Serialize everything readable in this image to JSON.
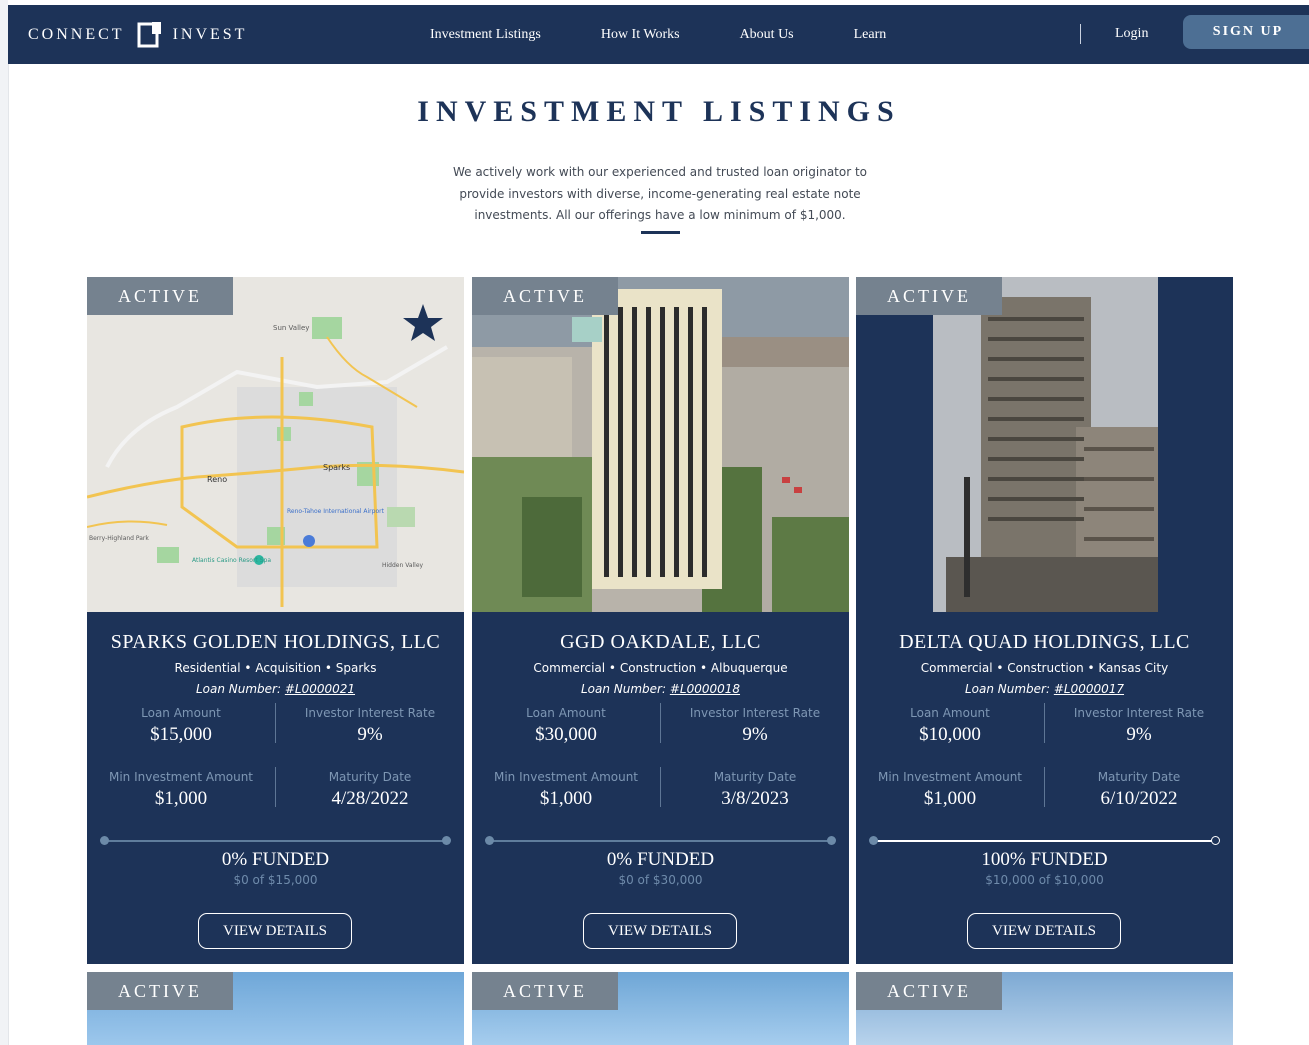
{
  "nav": {
    "logo_left": "CONNECT",
    "logo_right": "INVEST",
    "links": [
      "Investment Listings",
      "How It Works",
      "About Us",
      "Learn"
    ],
    "login": "Login",
    "signup": "SIGN UP"
  },
  "hero": {
    "title": "INVESTMENT LISTINGS",
    "intro": "We actively work with our experienced and trusted loan originator to provide investors with diverse, income-generating real estate note investments. All our offerings have a low minimum of $1,000."
  },
  "labels": {
    "loan_amount": "Loan Amount",
    "interest_rate": "Investor Interest Rate",
    "min_investment": "Min Investment Amount",
    "maturity": "Maturity Date",
    "loan_number_prefix": "Loan Number: ",
    "view_details": "VIEW DETAILS"
  },
  "listings": [
    {
      "status": "ACTIVE",
      "name": "SPARKS GOLDEN HOLDINGS, LLC",
      "tags": "Residential • Acquisition • Sparks",
      "loan_number": "#L0000021",
      "loan_amount": "$15,000",
      "interest_rate": "9%",
      "min_investment": "$1,000",
      "maturity": "4/28/2022",
      "funded": "0% FUNDED",
      "funded_detail": "$0 of $15,000",
      "funded_fraction": 0,
      "map_labels": [
        "Sun Valley",
        "Reno",
        "Sparks",
        "Reno-Tahoe International Airport",
        "Atlantis Casino Resort Spa",
        "Hidden Valley",
        "Berry-Highland Park"
      ]
    },
    {
      "status": "ACTIVE",
      "name": "GGD OAKDALE, LLC",
      "tags": "Commercial • Construction • Albuquerque",
      "loan_number": "#L0000018",
      "loan_amount": "$30,000",
      "interest_rate": "9%",
      "min_investment": "$1,000",
      "maturity": "3/8/2023",
      "funded": "0% FUNDED",
      "funded_detail": "$0 of $30,000",
      "funded_fraction": 0
    },
    {
      "status": "ACTIVE",
      "name": "DELTA QUAD HOLDINGS, LLC",
      "tags": "Commercial • Construction • Kansas City",
      "loan_number": "#L0000017",
      "loan_amount": "$10,000",
      "interest_rate": "9%",
      "min_investment": "$1,000",
      "maturity": "6/10/2022",
      "funded": "100% FUNDED",
      "funded_detail": "$10,000 of $10,000",
      "funded_fraction": 1
    }
  ],
  "next_row": [
    {
      "status": "ACTIVE"
    },
    {
      "status": "ACTIVE"
    },
    {
      "status": "ACTIVE"
    }
  ],
  "colors": {
    "navy": "#1d3358",
    "badge_gray": "#75828f",
    "signup_blue": "#4d6f94"
  }
}
